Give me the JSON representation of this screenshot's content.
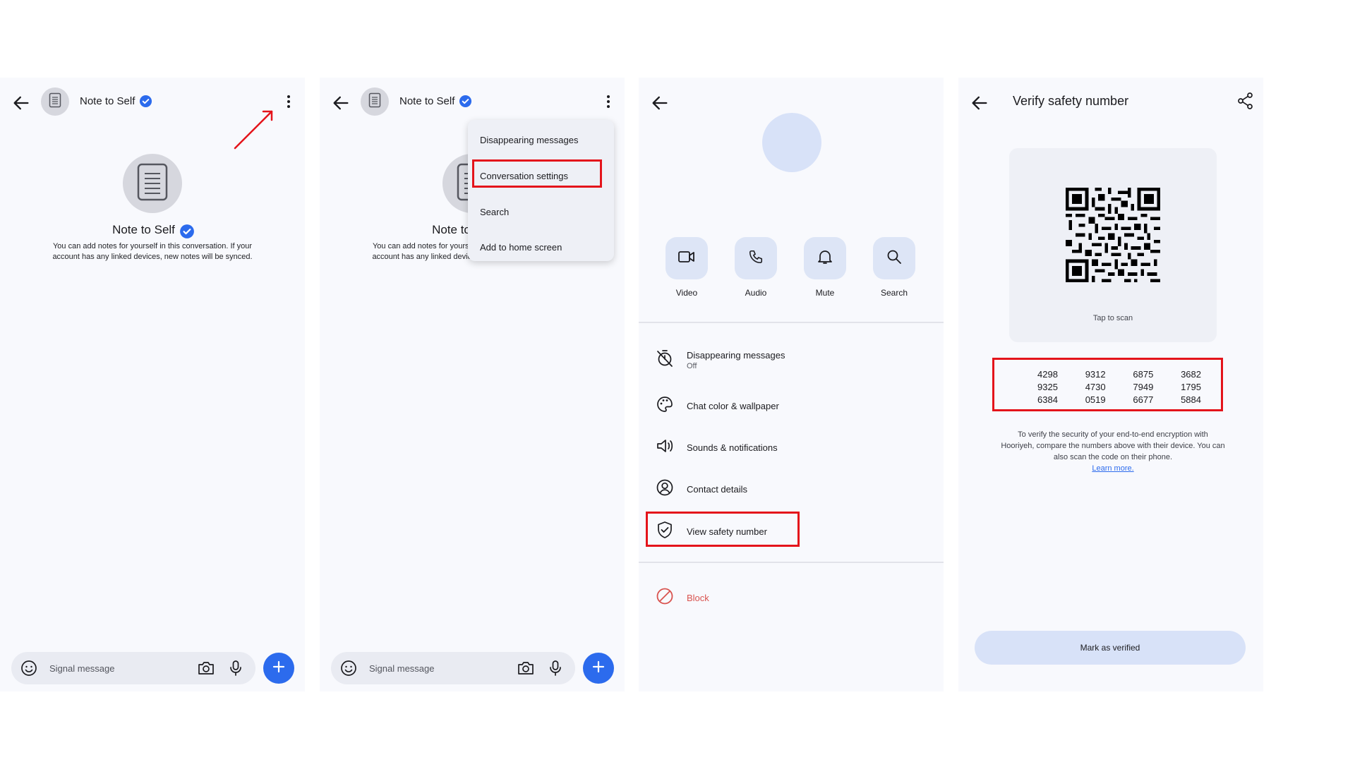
{
  "colors": {
    "accent": "#2c6bed",
    "highlight": "#e4141b",
    "block": "#d9534f",
    "panel_bg": "#f8f9fd"
  },
  "chat": {
    "title": "Note to Self",
    "heading": "Note to Self",
    "description": "You can add notes for yourself in this conversation. If your account has any linked devices, new notes will be synced.",
    "compose_placeholder": "Signal message"
  },
  "menu": {
    "items": [
      "Disappearing messages",
      "Conversation settings",
      "Search",
      "Add to home screen"
    ],
    "highlighted_index": 1
  },
  "settings": {
    "actions": [
      {
        "label": "Video",
        "icon": "video-icon"
      },
      {
        "label": "Audio",
        "icon": "phone-icon"
      },
      {
        "label": "Mute",
        "icon": "bell-icon"
      },
      {
        "label": "Search",
        "icon": "search-icon"
      }
    ],
    "rows": [
      {
        "label": "Disappearing messages",
        "sub": "Off",
        "icon": "timer-off-icon"
      },
      {
        "label": "Chat color & wallpaper",
        "icon": "palette-icon"
      },
      {
        "label": "Sounds & notifications",
        "icon": "speaker-icon"
      },
      {
        "label": "Contact details",
        "icon": "person-icon"
      },
      {
        "label": "View safety number",
        "icon": "shield-check-icon"
      }
    ],
    "block_label": "Block"
  },
  "verify": {
    "title": "Verify safety number",
    "tap_to_scan": "Tap to scan",
    "numbers": [
      [
        "4298",
        "9312",
        "6875",
        "3682"
      ],
      [
        "9325",
        "4730",
        "7949",
        "1795"
      ],
      [
        "6384",
        "0519",
        "6677",
        "5884"
      ]
    ],
    "description": "To verify the security of your end-to-end encryption with Hooriyeh, compare the numbers above with their device. You can also scan the code on their phone.",
    "learn_more": "Learn more.",
    "mark_verified_label": "Mark as verified"
  }
}
